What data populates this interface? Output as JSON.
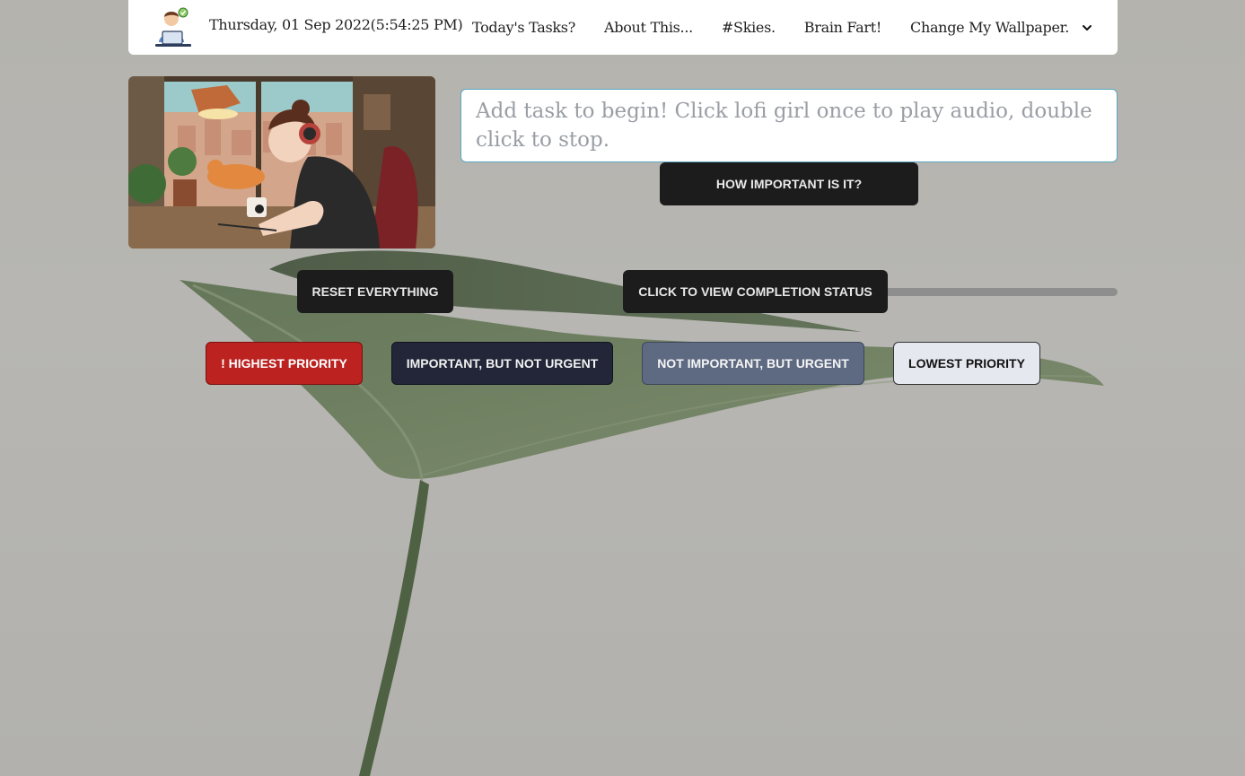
{
  "navbar": {
    "datetime": "Thursday, 01 Sep 2022(5:54:25 PM)",
    "links": [
      "Today's Tasks?",
      "About This...",
      "#Skies.",
      "Brain Fart!"
    ],
    "dropdown_label": "Change My Wallpaper.",
    "logo_icon": "person-at-laptop-icon",
    "dropdown_icon": "chevron-down-icon"
  },
  "lofi_image": {
    "name": "lofi-girl-studying-illustration"
  },
  "task_input": {
    "value": "",
    "placeholder": "Add task to begin! Click lofi girl once to play audio, double click to stop."
  },
  "buttons": {
    "how_important": "How important is it?",
    "reset": "Reset Everything",
    "status": "Click to view completion status"
  },
  "progress": {
    "fraction": 0
  },
  "priorities": {
    "highest": "! Highest Priority",
    "important": "Important, but not urgent",
    "urgent": "Not important, but urgent",
    "lowest": "Lowest Priority"
  },
  "colors": {
    "highest": "#bb2220",
    "important": "#222638",
    "urgent": "#5e6a82",
    "lowest": "#e6e8ef",
    "dark_button": "#1c1c1c",
    "progress_track": "#8e8e8e"
  }
}
